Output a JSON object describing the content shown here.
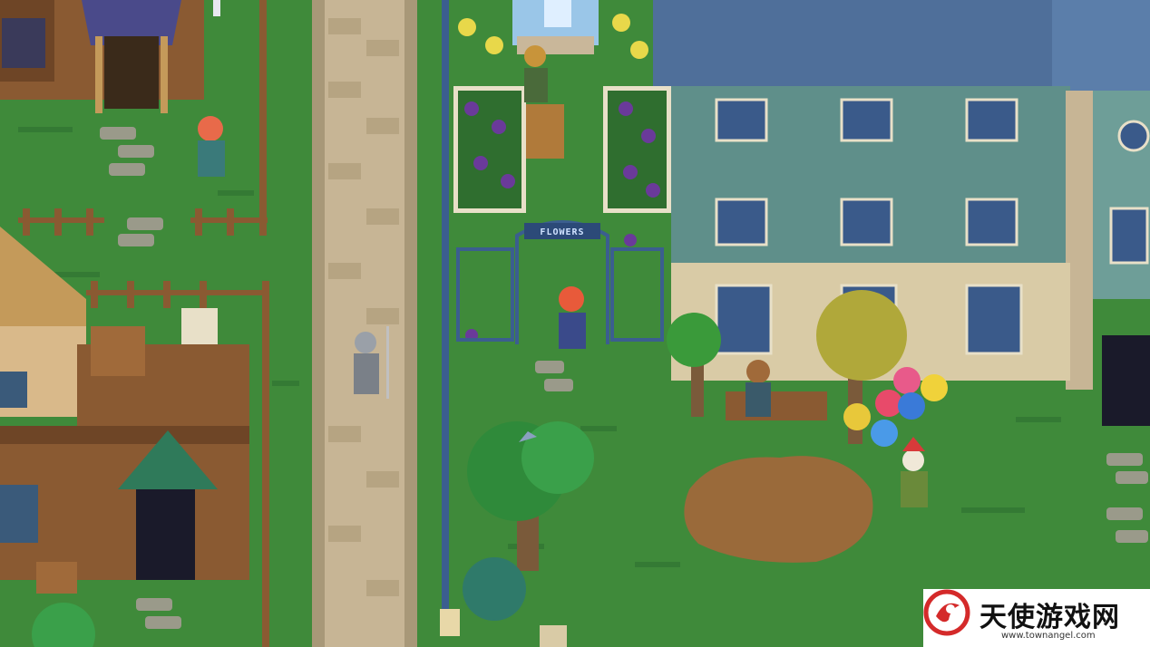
{
  "game": {
    "scene_description_hidden": "",
    "arch_sign": "FLOWERS"
  },
  "watermark": {
    "title": "天使游戏网",
    "url": "www.townangel.com"
  },
  "palette": {
    "grass": "#3f8a3a",
    "grass_dark": "#2f6e2f",
    "path": "#c9b79a",
    "wood": "#8a5a32",
    "roof_blue": "#4f6f9a",
    "wall_teal": "#5f8f8a",
    "stone": "#d9cba6",
    "dirt": "#9a6a3a",
    "logo_red": "#d42a2a"
  }
}
